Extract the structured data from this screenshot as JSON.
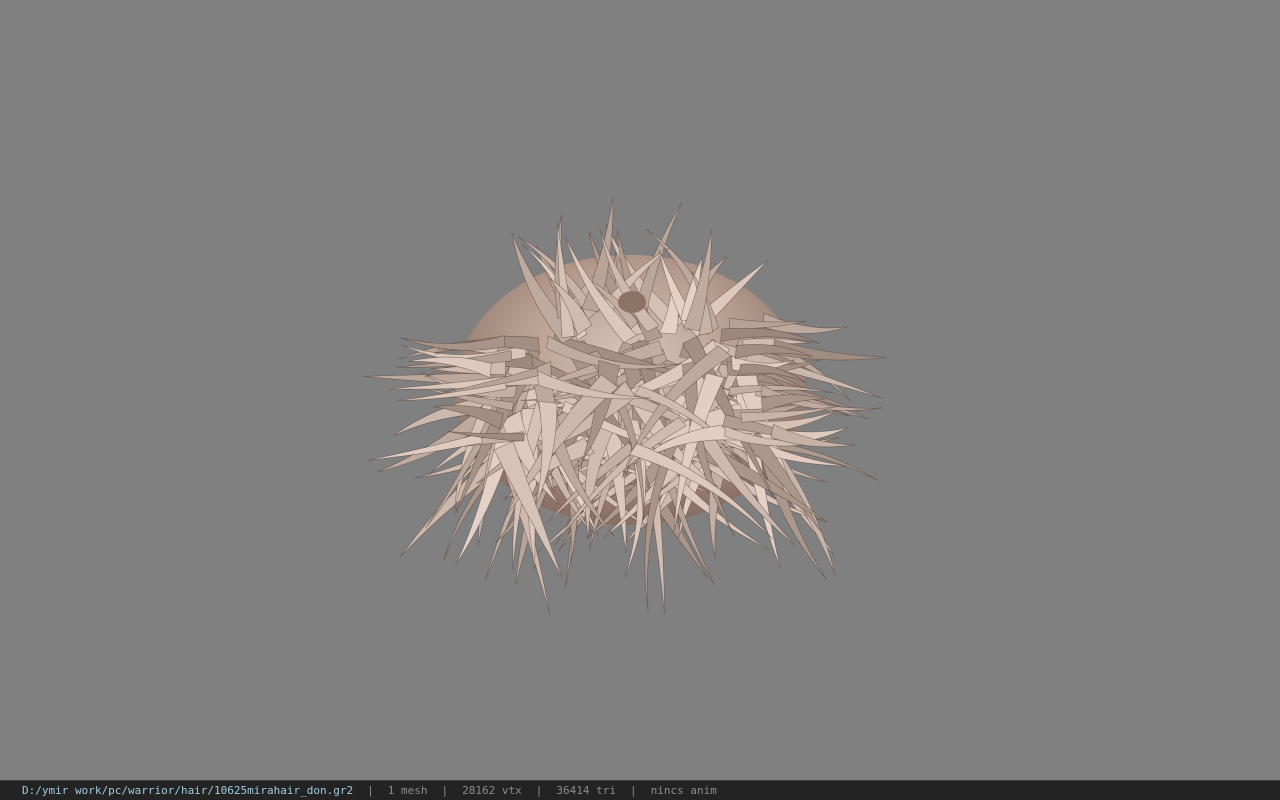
{
  "viewer": {
    "background_color": "#808080",
    "model": {
      "icon": "hair-mesh-model",
      "base_color": "#b49a8c"
    }
  },
  "statusbar": {
    "file_path": "D:/ymir work/pc/warrior/hair/10625mirahair_don.gr2",
    "separator": "|",
    "mesh_count": "1 mesh",
    "vertex_count": "28162 vtx",
    "triangle_count": "36414 tri",
    "anim_status": "nincs anim"
  }
}
